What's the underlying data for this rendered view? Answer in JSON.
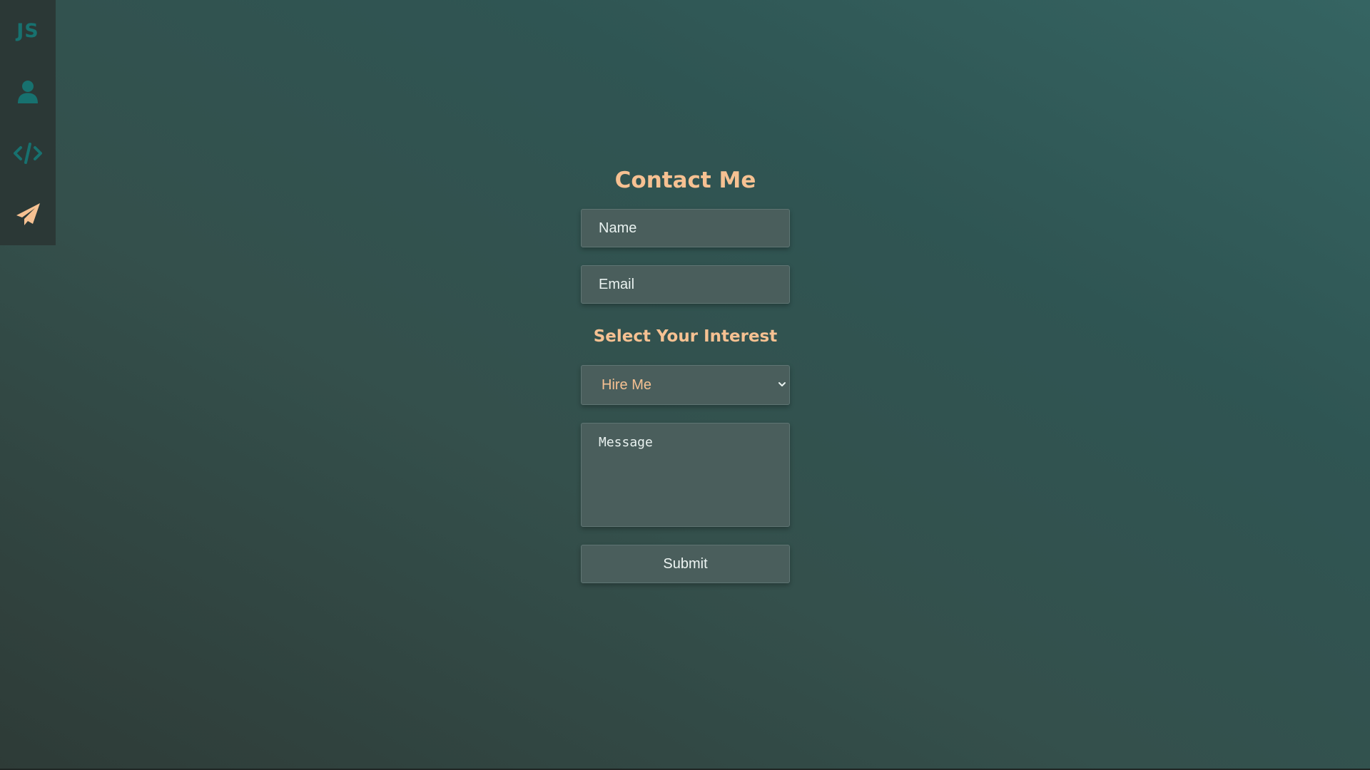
{
  "sidebar": {
    "logo": "JS",
    "items": [
      {
        "icon": "user-icon",
        "label": "About"
      },
      {
        "icon": "code-icon",
        "label": "Projects"
      },
      {
        "icon": "paper-plane-icon",
        "label": "Contact"
      }
    ]
  },
  "form": {
    "title": "Contact Me",
    "name_placeholder": "Name",
    "email_placeholder": "Email",
    "interest_label": "Select Your Interest",
    "interest_selected": "Hire Me",
    "message_placeholder": "Message",
    "submit_label": "Submit"
  },
  "colors": {
    "accent": "#f6c192",
    "sidebar_icon": "#17716f",
    "sidebar_bg": "#2b3836",
    "field_bg": "#4a5e5c"
  }
}
